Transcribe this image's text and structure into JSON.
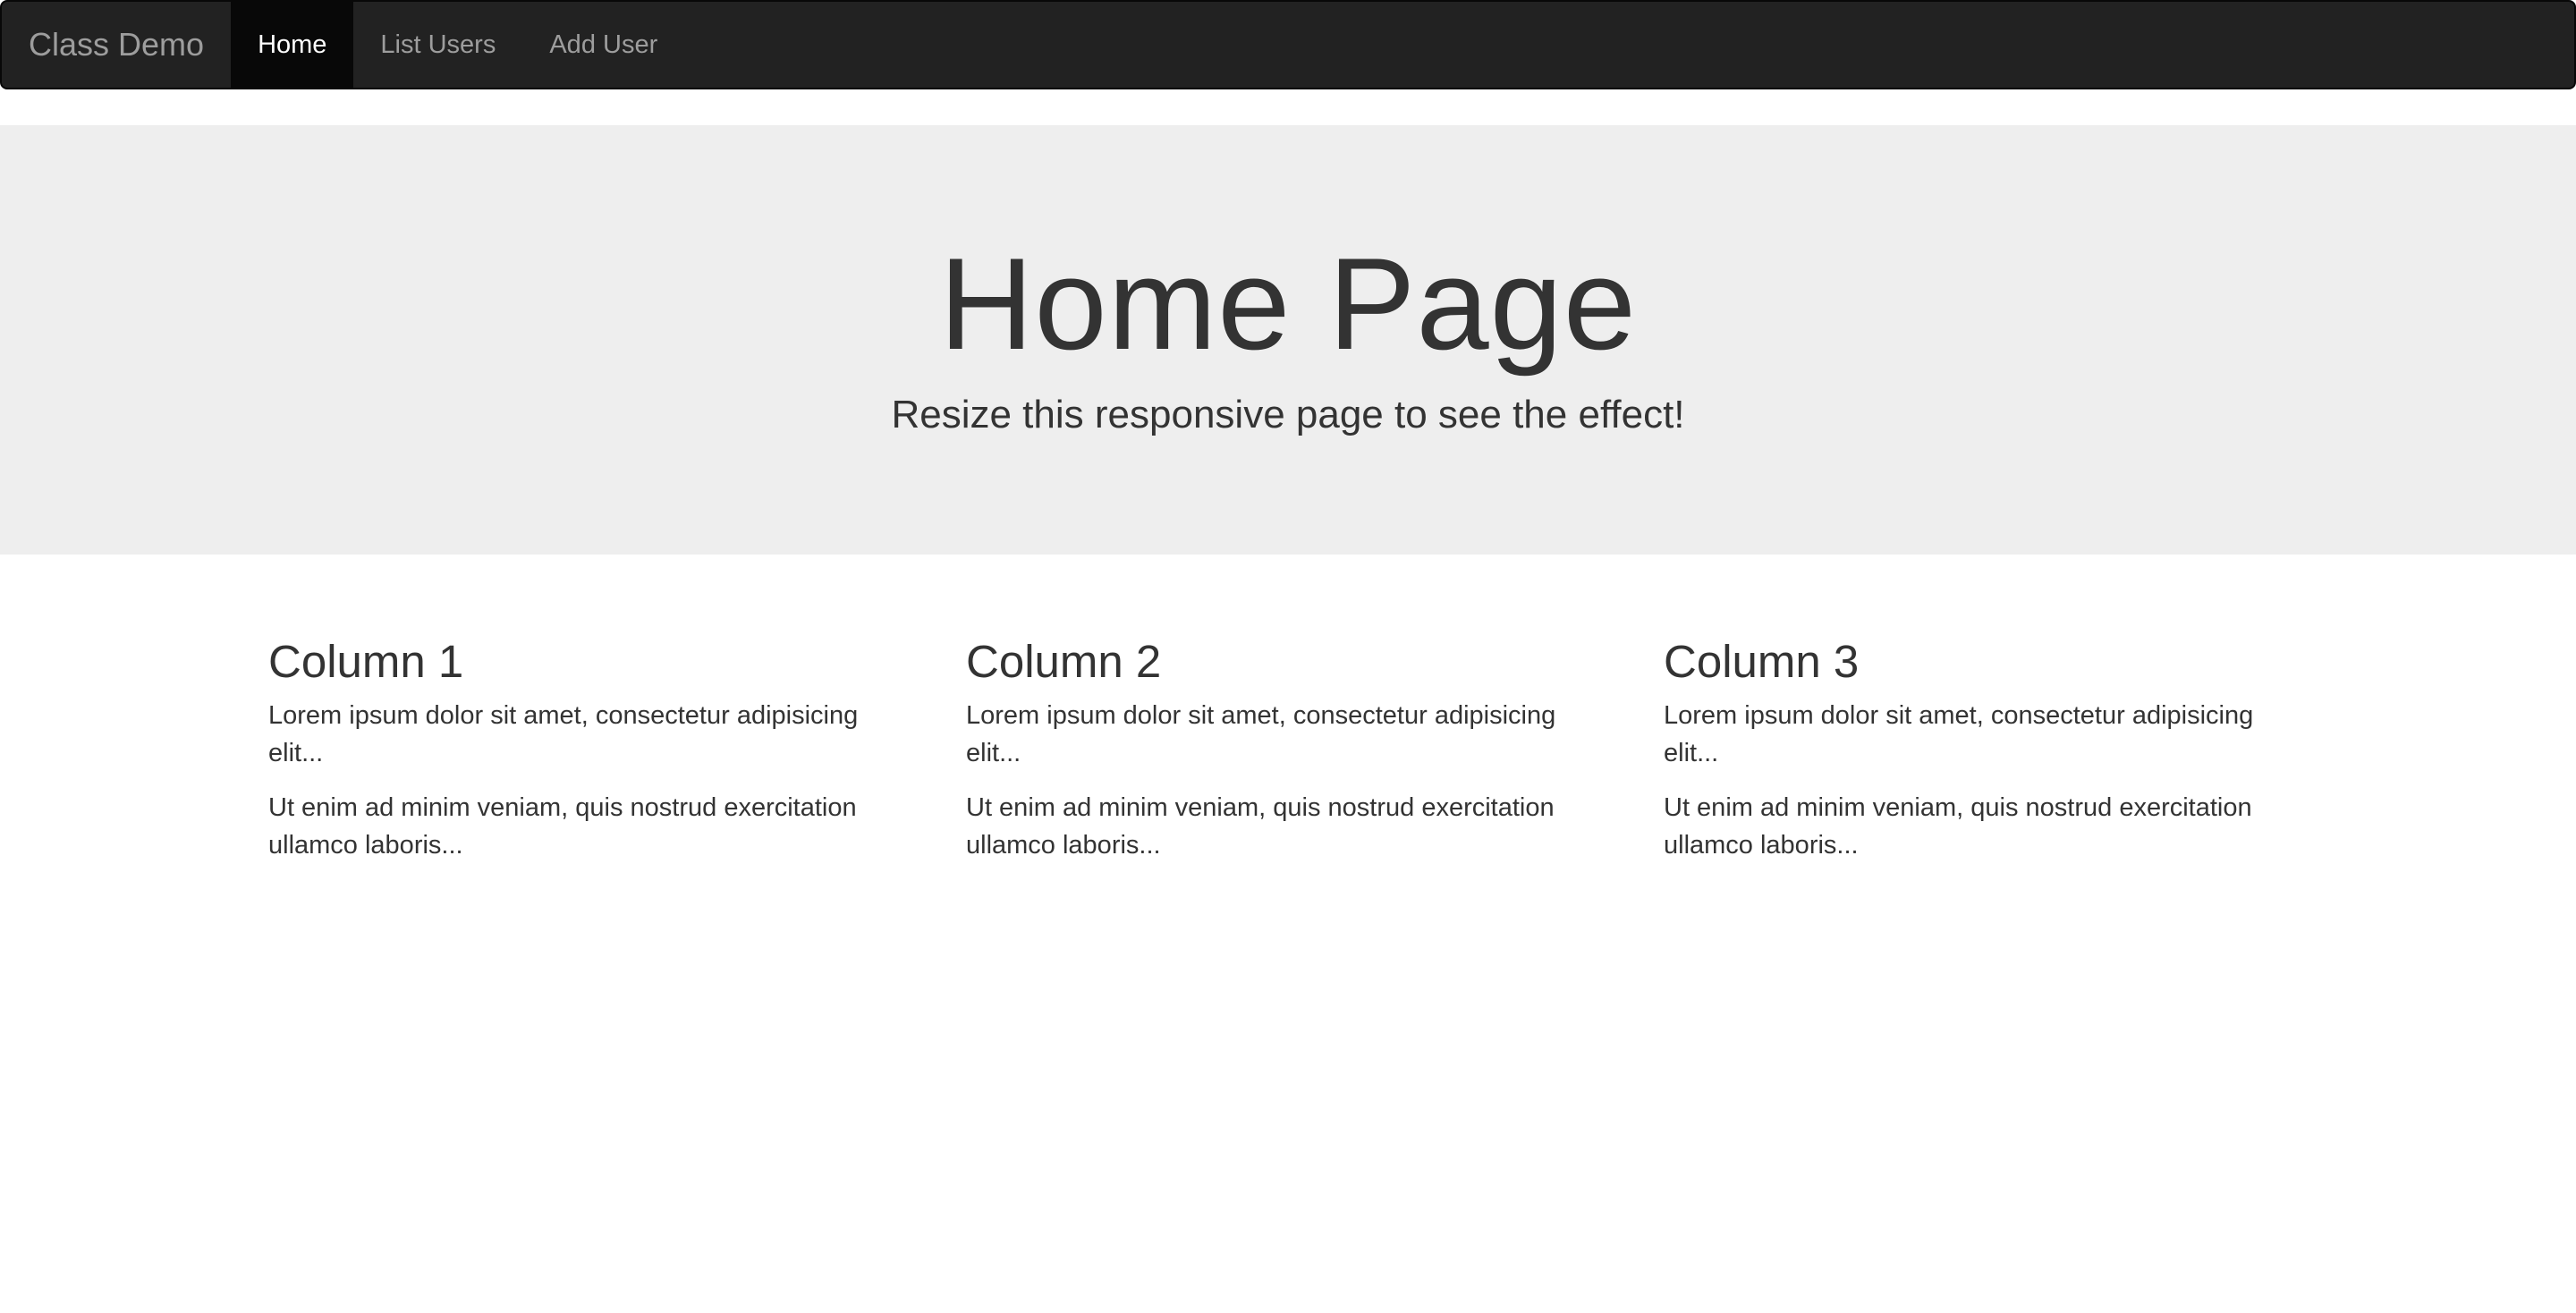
{
  "navbar": {
    "brand": "Class Demo",
    "items": [
      {
        "label": "Home",
        "active": true
      },
      {
        "label": "List Users",
        "active": false
      },
      {
        "label": "Add User",
        "active": false
      }
    ]
  },
  "hero": {
    "title": "Home Page",
    "subtitle": "Resize this responsive page to see the effect!"
  },
  "columns": [
    {
      "heading": "Column 1",
      "para1": "Lorem ipsum dolor sit amet, consectetur adipisicing elit...",
      "para2": "Ut enim ad minim veniam, quis nostrud exercitation ullamco laboris..."
    },
    {
      "heading": "Column 2",
      "para1": "Lorem ipsum dolor sit amet, consectetur adipisicing elit...",
      "para2": "Ut enim ad minim veniam, quis nostrud exercitation ullamco laboris..."
    },
    {
      "heading": "Column 3",
      "para1": "Lorem ipsum dolor sit amet, consectetur adipisicing elit...",
      "para2": "Ut enim ad minim veniam, quis nostrud exercitation ullamco laboris..."
    }
  ],
  "colors": {
    "navbar_bg": "#222222",
    "navbar_active_bg": "#080808",
    "nav_text": "#9d9d9d",
    "jumbotron_bg": "#eeeeee",
    "text": "#333333"
  }
}
